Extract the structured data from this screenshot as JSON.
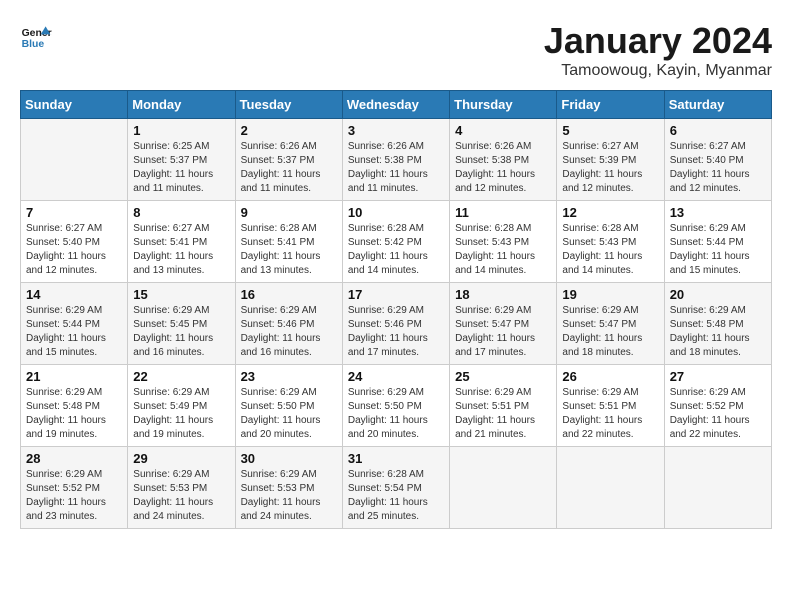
{
  "header": {
    "logo_line1": "General",
    "logo_line2": "Blue",
    "month": "January 2024",
    "location": "Tamoowoug, Kayin, Myanmar"
  },
  "days_of_week": [
    "Sunday",
    "Monday",
    "Tuesday",
    "Wednesday",
    "Thursday",
    "Friday",
    "Saturday"
  ],
  "weeks": [
    [
      {
        "day": "",
        "info": ""
      },
      {
        "day": "1",
        "info": "Sunrise: 6:25 AM\nSunset: 5:37 PM\nDaylight: 11 hours\nand 11 minutes."
      },
      {
        "day": "2",
        "info": "Sunrise: 6:26 AM\nSunset: 5:37 PM\nDaylight: 11 hours\nand 11 minutes."
      },
      {
        "day": "3",
        "info": "Sunrise: 6:26 AM\nSunset: 5:38 PM\nDaylight: 11 hours\nand 11 minutes."
      },
      {
        "day": "4",
        "info": "Sunrise: 6:26 AM\nSunset: 5:38 PM\nDaylight: 11 hours\nand 12 minutes."
      },
      {
        "day": "5",
        "info": "Sunrise: 6:27 AM\nSunset: 5:39 PM\nDaylight: 11 hours\nand 12 minutes."
      },
      {
        "day": "6",
        "info": "Sunrise: 6:27 AM\nSunset: 5:40 PM\nDaylight: 11 hours\nand 12 minutes."
      }
    ],
    [
      {
        "day": "7",
        "info": "Sunrise: 6:27 AM\nSunset: 5:40 PM\nDaylight: 11 hours\nand 12 minutes."
      },
      {
        "day": "8",
        "info": "Sunrise: 6:27 AM\nSunset: 5:41 PM\nDaylight: 11 hours\nand 13 minutes."
      },
      {
        "day": "9",
        "info": "Sunrise: 6:28 AM\nSunset: 5:41 PM\nDaylight: 11 hours\nand 13 minutes."
      },
      {
        "day": "10",
        "info": "Sunrise: 6:28 AM\nSunset: 5:42 PM\nDaylight: 11 hours\nand 14 minutes."
      },
      {
        "day": "11",
        "info": "Sunrise: 6:28 AM\nSunset: 5:43 PM\nDaylight: 11 hours\nand 14 minutes."
      },
      {
        "day": "12",
        "info": "Sunrise: 6:28 AM\nSunset: 5:43 PM\nDaylight: 11 hours\nand 14 minutes."
      },
      {
        "day": "13",
        "info": "Sunrise: 6:29 AM\nSunset: 5:44 PM\nDaylight: 11 hours\nand 15 minutes."
      }
    ],
    [
      {
        "day": "14",
        "info": "Sunrise: 6:29 AM\nSunset: 5:44 PM\nDaylight: 11 hours\nand 15 minutes."
      },
      {
        "day": "15",
        "info": "Sunrise: 6:29 AM\nSunset: 5:45 PM\nDaylight: 11 hours\nand 16 minutes."
      },
      {
        "day": "16",
        "info": "Sunrise: 6:29 AM\nSunset: 5:46 PM\nDaylight: 11 hours\nand 16 minutes."
      },
      {
        "day": "17",
        "info": "Sunrise: 6:29 AM\nSunset: 5:46 PM\nDaylight: 11 hours\nand 17 minutes."
      },
      {
        "day": "18",
        "info": "Sunrise: 6:29 AM\nSunset: 5:47 PM\nDaylight: 11 hours\nand 17 minutes."
      },
      {
        "day": "19",
        "info": "Sunrise: 6:29 AM\nSunset: 5:47 PM\nDaylight: 11 hours\nand 18 minutes."
      },
      {
        "day": "20",
        "info": "Sunrise: 6:29 AM\nSunset: 5:48 PM\nDaylight: 11 hours\nand 18 minutes."
      }
    ],
    [
      {
        "day": "21",
        "info": "Sunrise: 6:29 AM\nSunset: 5:48 PM\nDaylight: 11 hours\nand 19 minutes."
      },
      {
        "day": "22",
        "info": "Sunrise: 6:29 AM\nSunset: 5:49 PM\nDaylight: 11 hours\nand 19 minutes."
      },
      {
        "day": "23",
        "info": "Sunrise: 6:29 AM\nSunset: 5:50 PM\nDaylight: 11 hours\nand 20 minutes."
      },
      {
        "day": "24",
        "info": "Sunrise: 6:29 AM\nSunset: 5:50 PM\nDaylight: 11 hours\nand 20 minutes."
      },
      {
        "day": "25",
        "info": "Sunrise: 6:29 AM\nSunset: 5:51 PM\nDaylight: 11 hours\nand 21 minutes."
      },
      {
        "day": "26",
        "info": "Sunrise: 6:29 AM\nSunset: 5:51 PM\nDaylight: 11 hours\nand 22 minutes."
      },
      {
        "day": "27",
        "info": "Sunrise: 6:29 AM\nSunset: 5:52 PM\nDaylight: 11 hours\nand 22 minutes."
      }
    ],
    [
      {
        "day": "28",
        "info": "Sunrise: 6:29 AM\nSunset: 5:52 PM\nDaylight: 11 hours\nand 23 minutes."
      },
      {
        "day": "29",
        "info": "Sunrise: 6:29 AM\nSunset: 5:53 PM\nDaylight: 11 hours\nand 24 minutes."
      },
      {
        "day": "30",
        "info": "Sunrise: 6:29 AM\nSunset: 5:53 PM\nDaylight: 11 hours\nand 24 minutes."
      },
      {
        "day": "31",
        "info": "Sunrise: 6:28 AM\nSunset: 5:54 PM\nDaylight: 11 hours\nand 25 minutes."
      },
      {
        "day": "",
        "info": ""
      },
      {
        "day": "",
        "info": ""
      },
      {
        "day": "",
        "info": ""
      }
    ]
  ]
}
